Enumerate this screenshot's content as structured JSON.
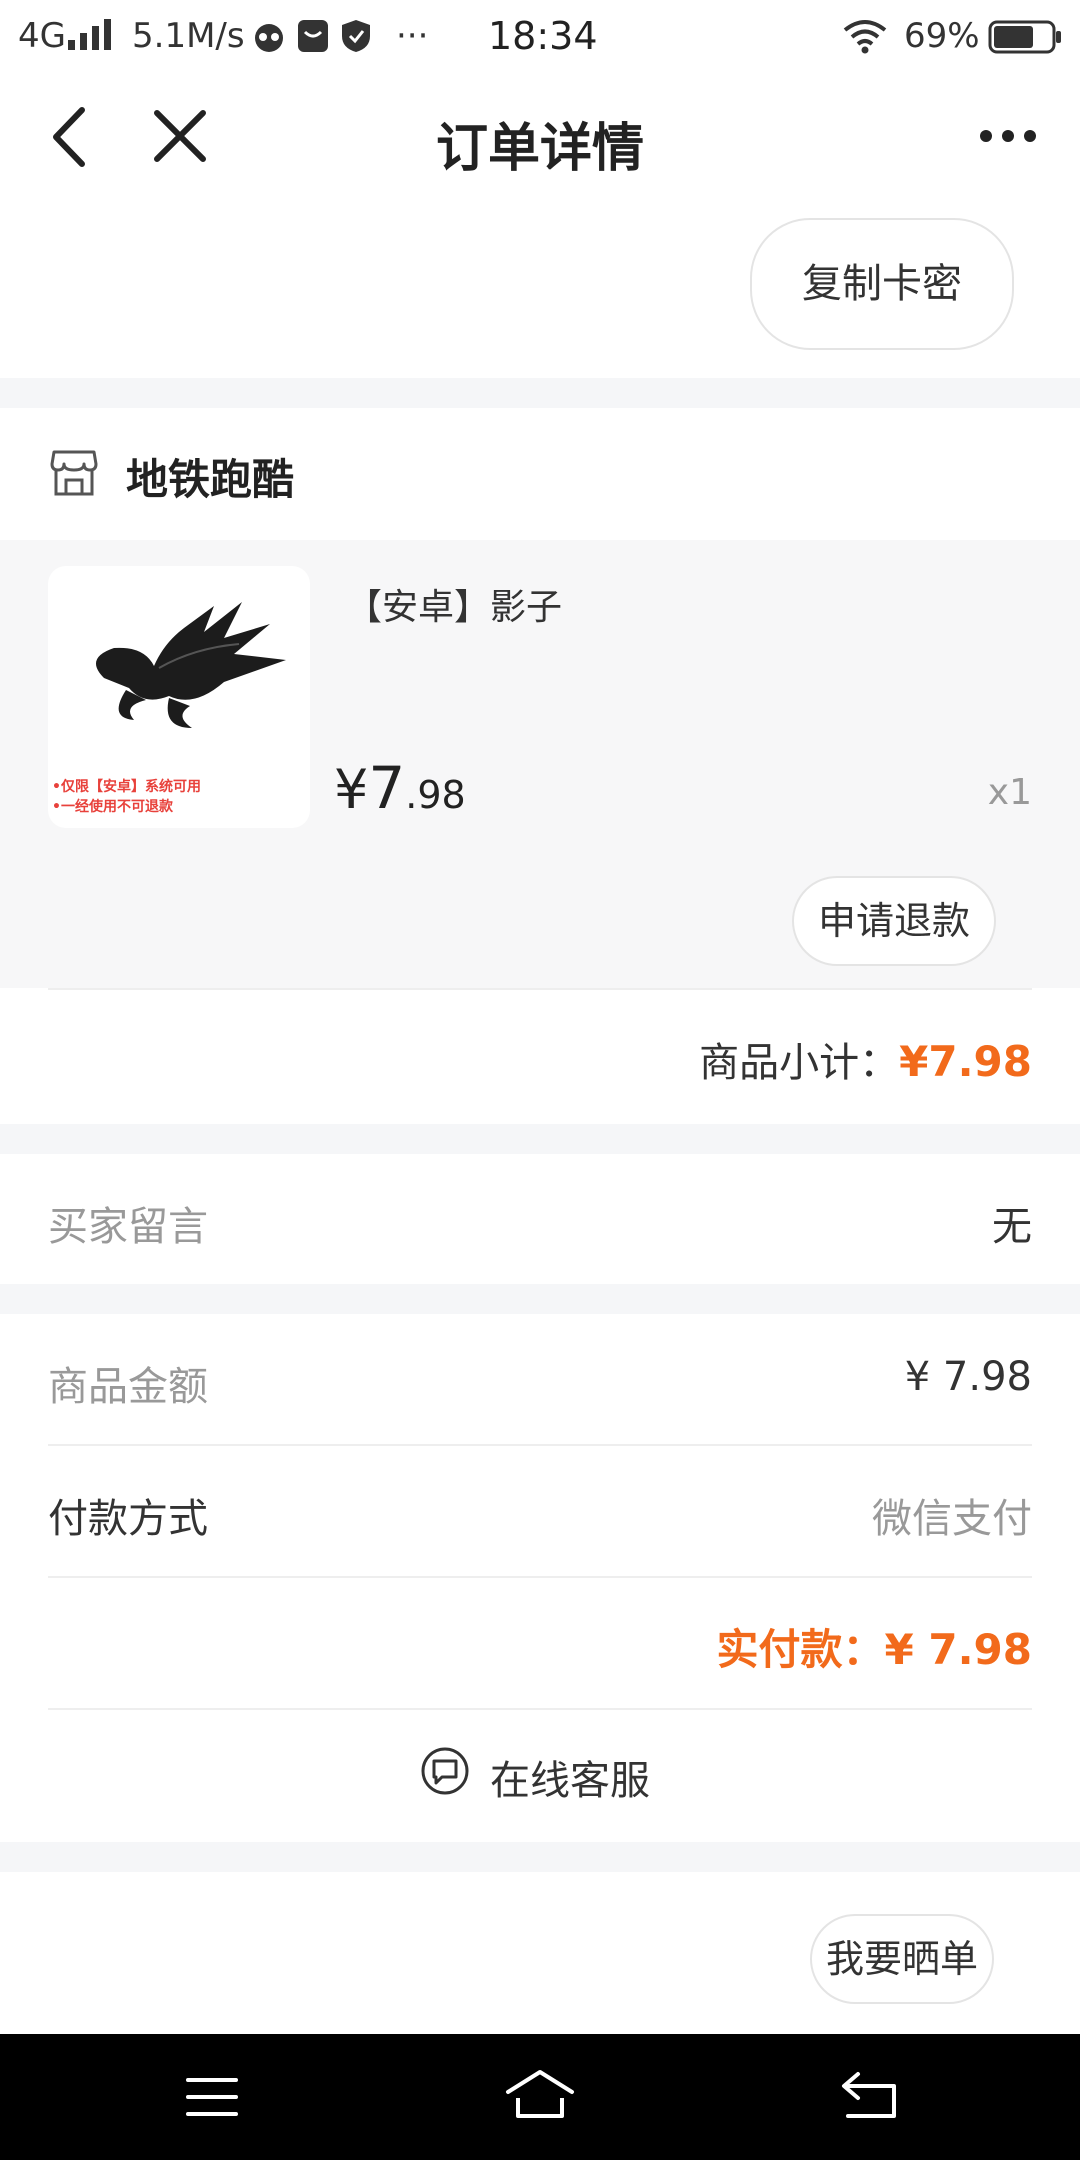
{
  "status_bar": {
    "network": "4G",
    "speed": "5.1M/s",
    "overflow": "···",
    "time": "18:34",
    "battery_pct": "69%",
    "battery_level": 0.69
  },
  "header": {
    "title": "订单详情"
  },
  "copy_button": "复制卡密",
  "shop": {
    "name": "地铁跑酷"
  },
  "product": {
    "title": "【安卓】影子",
    "price_currency": "¥",
    "price_int": "7",
    "price_dec": ".98",
    "quantity": "x1",
    "image_note_line1": "•仅限【安卓】系统可用",
    "image_note_line2": "•一经使用不可退款",
    "refund_button": "申请退款"
  },
  "subtotal": {
    "label": "商品小计：",
    "value": "¥7.98"
  },
  "buyer_message": {
    "label": "买家留言",
    "value": "无"
  },
  "amount": {
    "label": "商品金额",
    "value": "¥ 7.98"
  },
  "payment": {
    "label": "付款方式",
    "value": "微信支付"
  },
  "paid": {
    "text": "实付款：¥ 7.98"
  },
  "service": {
    "label": "在线客服"
  },
  "share_button": "我要晒单",
  "colors": {
    "accent": "#f26a1b",
    "background": "#f5f6f8"
  }
}
